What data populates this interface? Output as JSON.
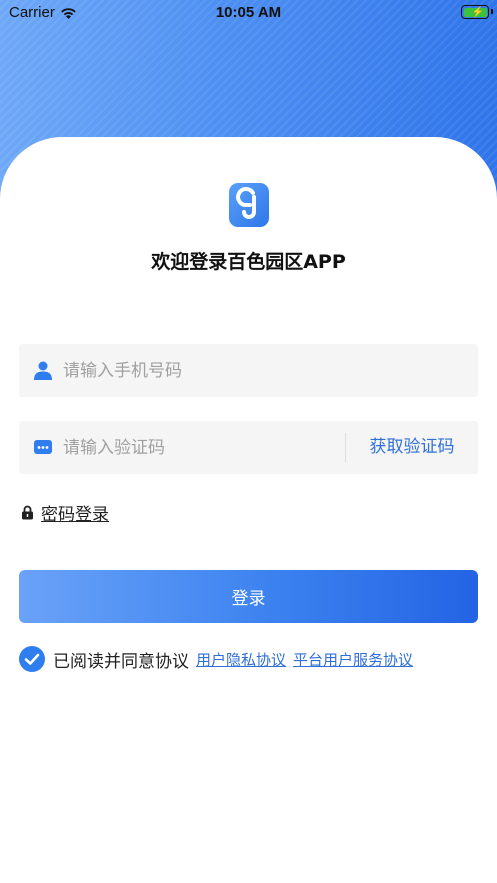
{
  "status_bar": {
    "carrier": "Carrier",
    "time": "10:05 AM",
    "battery_color": "#3bc13b"
  },
  "theme": {
    "accent": "#2f76ea",
    "link": "#2f6fd8",
    "field_bg": "#f5f5f5"
  },
  "header": {
    "logo_icon": "app-logo-icon",
    "title": "欢迎登录百色园区APP"
  },
  "form": {
    "phone": {
      "placeholder": "请输入手机号码",
      "value": "",
      "icon": "user-icon"
    },
    "code": {
      "placeholder": "请输入验证码",
      "value": "",
      "icon": "keyboard-icon",
      "get_code_label": "获取验证码"
    },
    "password_login": {
      "label": "密码登录",
      "icon": "lock-icon"
    },
    "login_button": "登录"
  },
  "agreement": {
    "checked": true,
    "text": "已阅读并同意协议",
    "links": [
      "用户隐私协议",
      "平台用户服务协议"
    ]
  }
}
